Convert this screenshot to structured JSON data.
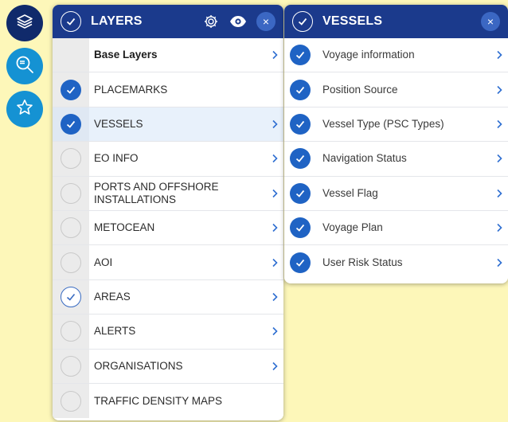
{
  "colors": {
    "navy": "#102a6b",
    "header_blue": "#1b3a8c",
    "accent_blue": "#1f63c4",
    "light_blue": "#1592d3",
    "map_bg": "#fdf7b9"
  },
  "side_buttons": [
    {
      "icon": "layers-icon",
      "active": true
    },
    {
      "icon": "search-icon",
      "active": false
    },
    {
      "icon": "star-icon",
      "active": false
    }
  ],
  "layers_panel": {
    "title": "LAYERS",
    "header_icons": [
      "settings-icon",
      "eye-icon",
      "close-icon"
    ],
    "close_label": "×",
    "items": [
      {
        "label": "Base Layers",
        "state": "none",
        "chevron": true
      },
      {
        "label": "PLACEMARKS",
        "state": "checked",
        "chevron": false
      },
      {
        "label": "VESSELS",
        "state": "checked",
        "chevron": true
      },
      {
        "label": "EO INFO",
        "state": "unchecked",
        "chevron": true
      },
      {
        "label": "PORTS AND OFFSHORE INSTALLATIONS",
        "state": "unchecked",
        "chevron": true
      },
      {
        "label": "METOCEAN",
        "state": "unchecked",
        "chevron": true
      },
      {
        "label": "AOI",
        "state": "unchecked",
        "chevron": true
      },
      {
        "label": "AREAS",
        "state": "partial",
        "chevron": true
      },
      {
        "label": "ALERTS",
        "state": "unchecked",
        "chevron": true
      },
      {
        "label": "ORGANISATIONS",
        "state": "unchecked",
        "chevron": true
      },
      {
        "label": "TRAFFIC DENSITY MAPS",
        "state": "unchecked",
        "chevron": false
      }
    ]
  },
  "vessels_panel": {
    "title": "VESSELS",
    "close_label": "×",
    "items": [
      {
        "label": "Voyage information",
        "state": "checked"
      },
      {
        "label": "Position Source",
        "state": "checked"
      },
      {
        "label": "Vessel Type (PSC Types)",
        "state": "checked"
      },
      {
        "label": "Navigation Status",
        "state": "checked"
      },
      {
        "label": "Vessel Flag",
        "state": "checked"
      },
      {
        "label": "Voyage Plan",
        "state": "checked"
      },
      {
        "label": "User Risk Status",
        "state": "checked"
      }
    ]
  }
}
